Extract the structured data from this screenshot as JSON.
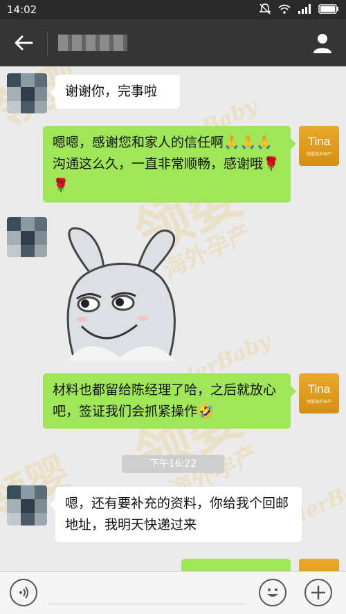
{
  "status_bar": {
    "time": "14:02",
    "icons": [
      "mute-icon",
      "wifi-icon",
      "signal-icon",
      "battery-icon"
    ]
  },
  "header": {
    "back_icon": "arrow-left-icon",
    "contact_name": "",
    "profile_icon": "person-icon"
  },
  "messages": [
    {
      "side": "in",
      "text": "谢谢你，完事啦"
    },
    {
      "side": "out",
      "text": "嗯嗯，感谢您和家人的信任啊🙏🙏🙏沟通这么久，一直非常顺畅，感谢哦🌹🌹"
    },
    {
      "side": "in",
      "type": "sticker",
      "sticker": "grinning-rabbit-sticker"
    },
    {
      "side": "out",
      "text": "材料也都留给陈经理了哈，之后就放心吧，签证我们会抓紧操作🤣"
    },
    {
      "type": "timestamp",
      "text": "下午16:22"
    },
    {
      "side": "in",
      "text": "嗯，还有要补充的资料，你给我个回邮地址，我明天快递过来"
    }
  ],
  "my_avatar": {
    "name": "Tina",
    "subtitle": "领婴海外孕产"
  },
  "watermark": {
    "cn": "领婴",
    "cn_sub": "海外孕产",
    "en": "LeaderBaby"
  },
  "input_bar": {
    "voice_icon": "voice-icon",
    "emoji_icon": "emoji-icon",
    "plus_icon": "plus-icon"
  },
  "colors": {
    "header": "#353535",
    "status": "#2a2a2a",
    "out_bubble": "#9fe659",
    "in_bubble": "#ffffff",
    "chat_bg": "#ebebeb",
    "avatar_gold": "#e3a321"
  }
}
